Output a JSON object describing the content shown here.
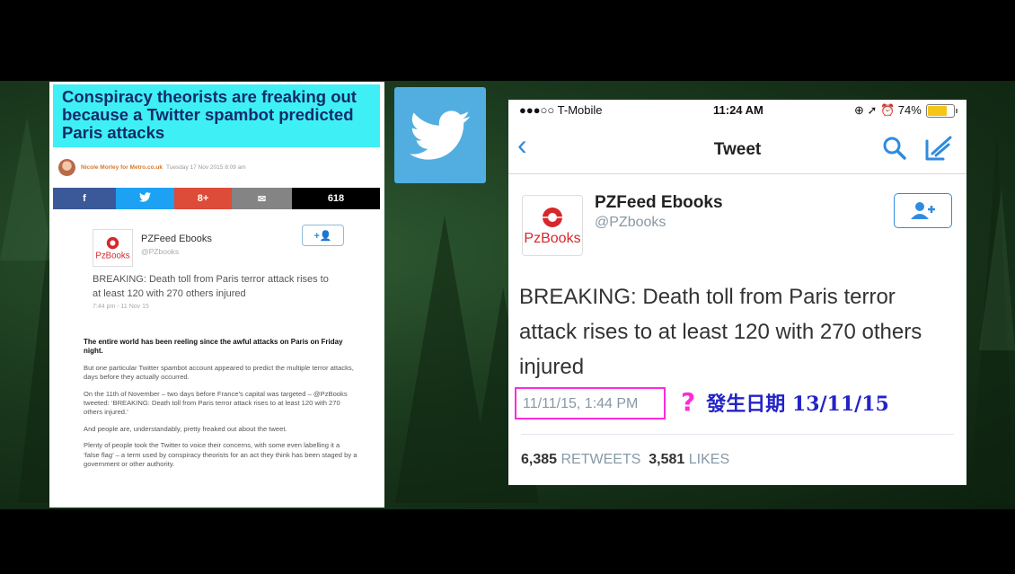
{
  "article": {
    "headline": "Conspiracy theorists are freaking out because a Twitter spambot predicted Paris attacks",
    "author": "Nicole Morley for Metro.co.uk",
    "date": "Tuesday 17 Nov 2015 8:09 am",
    "share": {
      "facebook": "f",
      "twitter": "🐦",
      "googleplus": "8+",
      "email": "✉",
      "count": "618"
    },
    "embedded_tweet": {
      "name": "PZFeed Ebooks",
      "handle": "@PZbooks",
      "follow": "+👤",
      "text": "BREAKING: Death toll from Paris terror attack rises to at least 120 with 270 others injured",
      "time": "7:44 pm - 11 Nov 15"
    },
    "paragraphs": [
      "The entire world has been reeling since the awful attacks on Paris on Friday night.",
      "But one particular Twitter spambot account appeared to predict the multiple terror attacks, days before they actually occurred.",
      "On the 11th of November – two days before France’s capital was targeted – @PzBooks tweeted: ‘BREAKING: Death toll from Paris terror attack rises to at least 120 with 270 others injured.’",
      "And people are, understandably, pretty freaked out about the tweet.",
      "Plenty of people took the Twitter to voice their concerns, with some even labelling it a ‘false flag’ – a term used by conspiracy theorists for an act they think has been staged by a government or other authority."
    ]
  },
  "phone": {
    "carrier": "●●●○○ T-Mobile",
    "time": "11:24 AM",
    "status_right": "⊕ ➚ ⏰ 74%",
    "battery_percent": 74,
    "nav_title": "Tweet",
    "name": "PZFeed Ebooks",
    "handle": "@PZbooks",
    "tweet_text": "BREAKING: Death toll from Paris terror attack rises to at least 120 with 270 others injured",
    "timestamp": "11/11/15, 1:44 PM",
    "retweets_count": "6,385",
    "retweets_label": "RETWEETS",
    "likes_count": "3,581",
    "likes_label": "LIKES"
  },
  "annotation": {
    "question_mark": "?",
    "text": "發生日期 13/11/15"
  },
  "logo": {
    "pz_text": "PzBooks"
  }
}
